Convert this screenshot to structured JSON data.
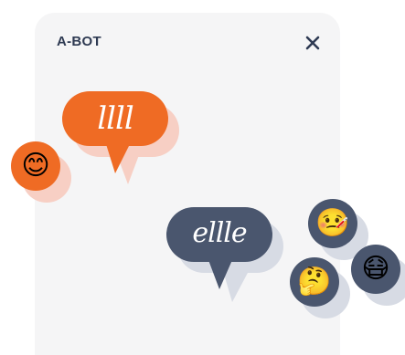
{
  "window": {
    "title": "A-BOT",
    "close_icon": "close-icon"
  },
  "colors": {
    "panel_bg": "#f5f5f6",
    "title": "#2e3a52",
    "orange": "#ef6b24",
    "orange_shadow": "#f7cfc4",
    "slate": "#4a566e",
    "slate_shadow": "#d7dbe4"
  },
  "chat": {
    "bubble_bot_text": "llll",
    "bubble_user_text": "ellle"
  },
  "emojis": {
    "smiling": {
      "icon": "smiling-face-icon",
      "glyph": "😊"
    },
    "sick": {
      "icon": "face-with-thermometer-icon",
      "glyph": "🤒"
    },
    "thinking": {
      "icon": "thinking-face-icon",
      "glyph": "🤔"
    },
    "mask": {
      "icon": "face-with-medical-mask-icon",
      "glyph": "😷"
    }
  }
}
